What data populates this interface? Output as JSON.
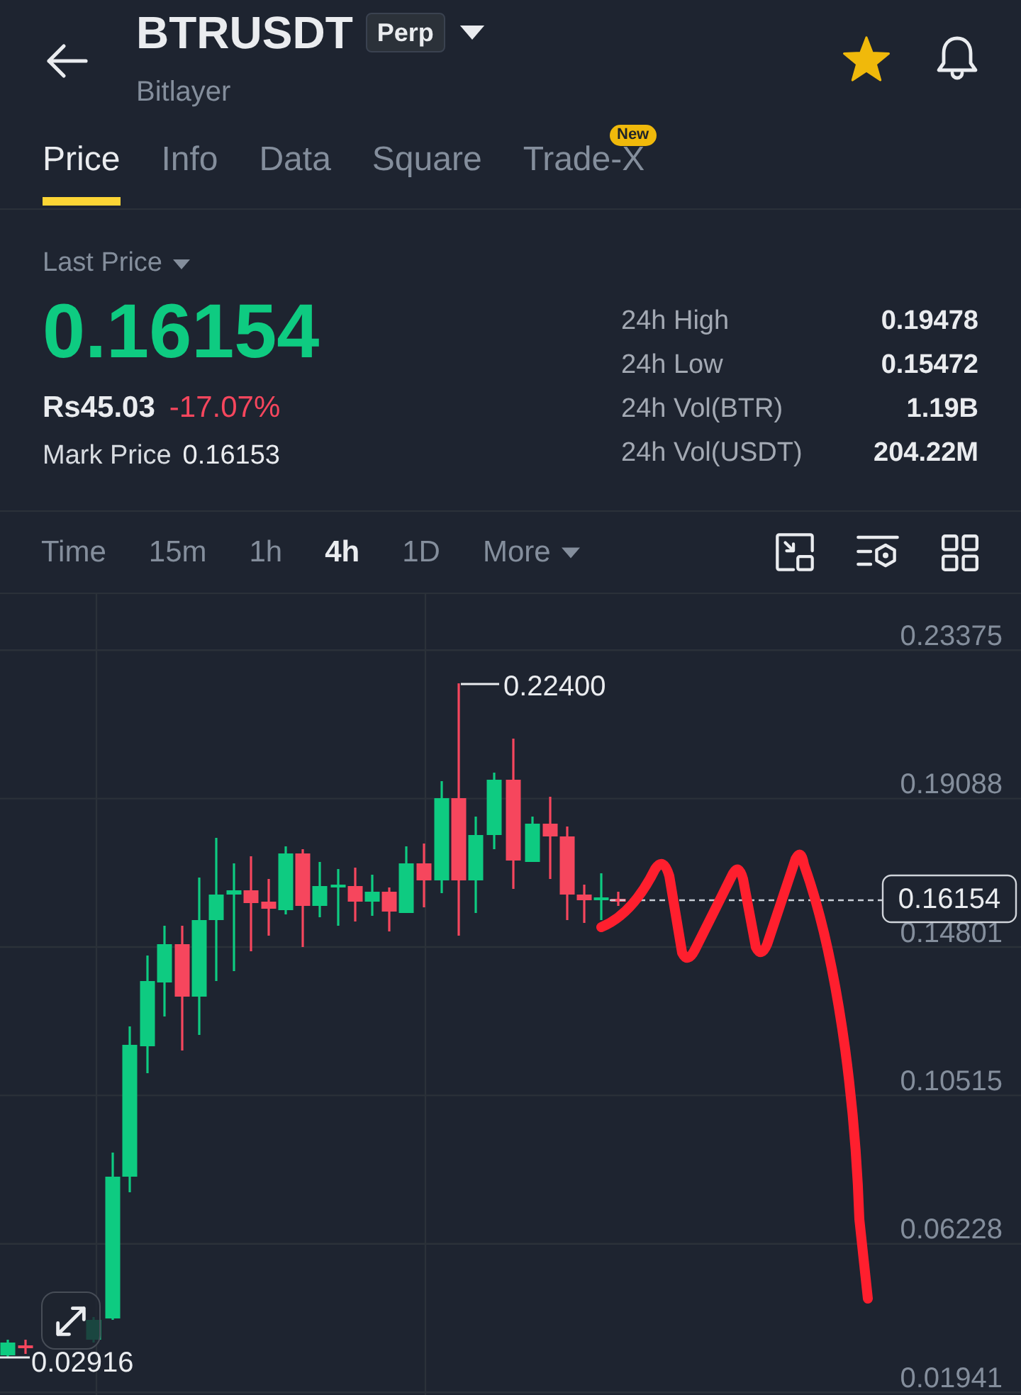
{
  "header": {
    "title": "BTRUSDT",
    "badge": "Perp",
    "subtitle": "Bitlayer",
    "favorited": true
  },
  "tabs": [
    {
      "label": "Price",
      "selected": true
    },
    {
      "label": "Info",
      "selected": false
    },
    {
      "label": "Data",
      "selected": false
    },
    {
      "label": "Square",
      "selected": false
    },
    {
      "label": "Trade-X",
      "selected": false,
      "badge": "New"
    }
  ],
  "price_panel": {
    "label": "Last Price",
    "last_price": "0.16154",
    "local_price": "Rs45.03",
    "change": "-17.07%",
    "mark_price_label": "Mark Price",
    "mark_price": "0.16153"
  },
  "stats": [
    {
      "label": "24h High",
      "value": "0.19478"
    },
    {
      "label": "24h Low",
      "value": "0.15472"
    },
    {
      "label": "24h Vol(BTR)",
      "value": "1.19B"
    },
    {
      "label": "24h Vol(USDT)",
      "value": "204.22M"
    }
  ],
  "intervals": [
    {
      "label": "Time",
      "kind": "interval",
      "selected": false
    },
    {
      "label": "15m",
      "kind": "interval",
      "selected": false
    },
    {
      "label": "1h",
      "kind": "interval",
      "selected": false
    },
    {
      "label": "4h",
      "kind": "interval",
      "selected": true
    },
    {
      "label": "1D",
      "kind": "interval",
      "selected": false
    },
    {
      "label": "More",
      "kind": "menu",
      "selected": false
    }
  ],
  "chart": {
    "price_axis": [
      "0.23375",
      "0.19088",
      "0.14801",
      "0.10515",
      "0.06228",
      "0.01941"
    ],
    "high_label": "0.22400",
    "low_label": "0.02916",
    "current_price": "0.16154"
  }
}
